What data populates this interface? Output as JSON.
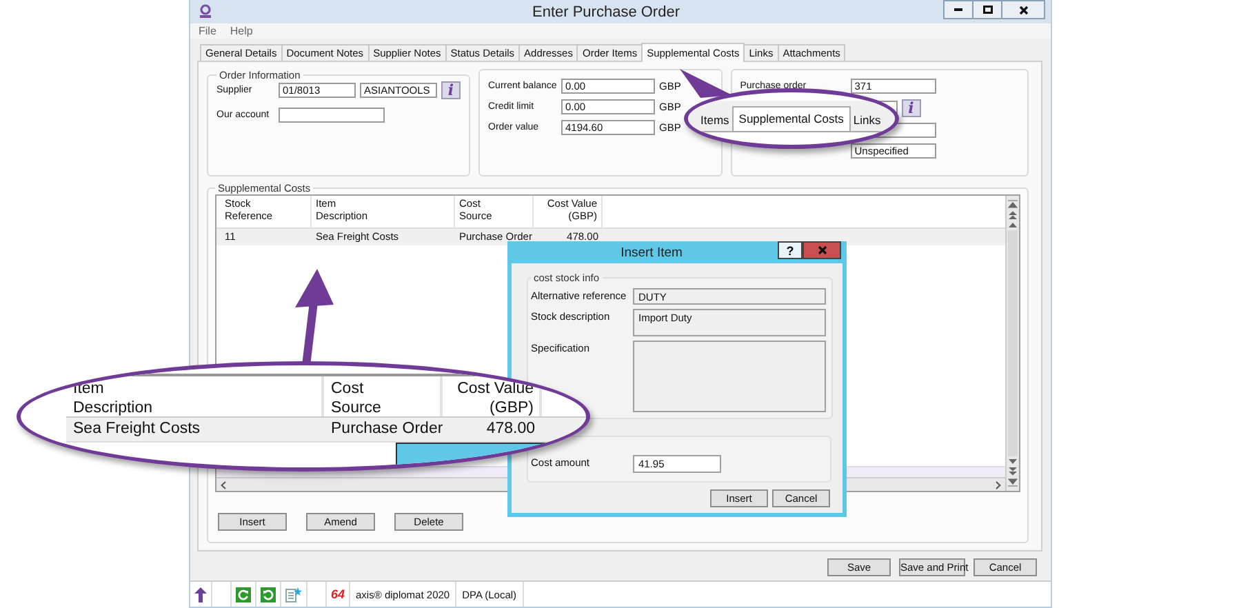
{
  "window": {
    "title": "Enter Purchase Order"
  },
  "menu": [
    "File",
    "Help"
  ],
  "tabs": [
    {
      "label": "General Details",
      "selected": false
    },
    {
      "label": "Document Notes",
      "selected": false
    },
    {
      "label": "Supplier Notes",
      "selected": false
    },
    {
      "label": "Status Details",
      "selected": false
    },
    {
      "label": "Addresses",
      "selected": false
    },
    {
      "label": "Order Items",
      "selected": false
    },
    {
      "label": "Supplemental Costs",
      "selected": true
    },
    {
      "label": "Links",
      "selected": false
    },
    {
      "label": "Attachments",
      "selected": false
    }
  ],
  "order_information": {
    "title": "Order Information",
    "fields": [
      {
        "label": "Supplier",
        "values": [
          "01/8013",
          "ASIANTOOLS"
        ],
        "info": "i"
      },
      {
        "label": "Our account"
      }
    ]
  },
  "balances": [
    {
      "label": "Current balance",
      "value": "0.00",
      "currency": "GBP"
    },
    {
      "label": "Credit limit",
      "value": "0.00",
      "currency": "GBP"
    },
    {
      "label": "Order value",
      "value": "4194.60",
      "currency": "GBP"
    }
  ],
  "order_details": [
    {
      "kind": "field",
      "label": "Purchase order",
      "value": "371"
    },
    {
      "kind": "field",
      "info": "i"
    },
    {
      "kind": "field"
    },
    {
      "kind": "field",
      "value": "Unspecified"
    }
  ],
  "supplemental_costs": {
    "title": "Supplemental Costs",
    "columns": [
      {
        "lines": [
          "Stock",
          "Reference"
        ]
      },
      {
        "lines": [
          "Item",
          "Description"
        ]
      },
      {
        "lines": [
          "Cost",
          "Source"
        ]
      },
      {
        "lines": [
          "Cost Value",
          "(GBP)"
        ]
      }
    ],
    "rows": [
      {
        "cells": [
          "11",
          "Sea Freight Costs",
          "Purchase Order",
          "478.00"
        ]
      }
    ],
    "buttons": [
      "Insert",
      "Amend",
      "Delete"
    ]
  },
  "footer_buttons": [
    "Save",
    "Save and Print",
    "Cancel"
  ],
  "status_bar": {
    "badge": "64",
    "product": "axis® diplomat 2020",
    "connection": "DPA (Local)"
  },
  "dialog": {
    "title": "Insert Item",
    "help": "?",
    "group": "cost stock info",
    "fields": [
      {
        "label": "Alternative reference",
        "value": "DUTY",
        "kind": "line"
      },
      {
        "label": "Stock description",
        "value": "Import Duty",
        "kind": "box"
      },
      {
        "label": "Specification",
        "kind": "area"
      }
    ],
    "amount": {
      "label": "Cost amount",
      "value": "41.95"
    },
    "buttons": [
      "Insert",
      "Cancel"
    ]
  },
  "callouts": [
    {
      "kind": "tabs",
      "tabs": [
        {
          "label": "Items",
          "selected": false
        },
        {
          "label": "Supplemental Costs",
          "selected": true
        },
        {
          "label": "Links",
          "selected": false
        }
      ]
    },
    {
      "kind": "table",
      "columns": [
        {
          "lines": [
            "Item",
            "Description"
          ]
        },
        {
          "lines": [
            "Cost",
            "Source"
          ]
        },
        {
          "lines": [
            "Cost Value",
            "(GBP)"
          ]
        }
      ],
      "row": [
        "Sea Freight Costs",
        "Purchase Order",
        "478.00"
      ]
    }
  ]
}
